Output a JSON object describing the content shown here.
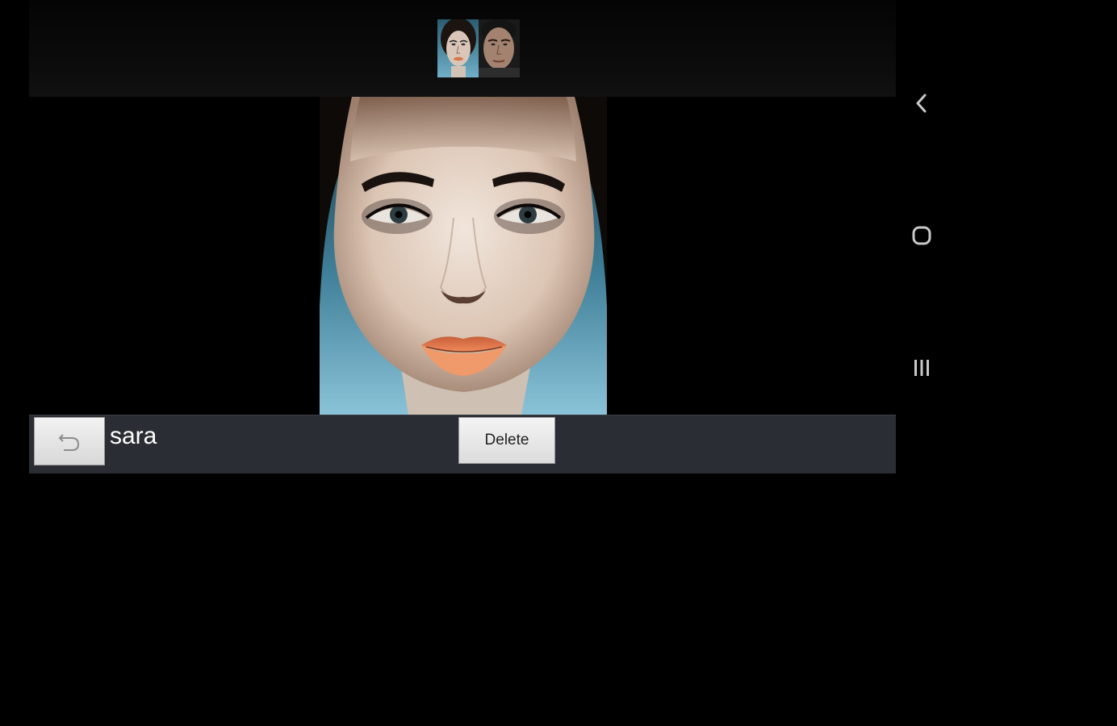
{
  "gallery": {
    "thumbnails": [
      {
        "icon": "woman-face-thumbnail"
      },
      {
        "icon": "man-face-thumbnail"
      }
    ]
  },
  "photo": {
    "icon": "woman-face-photo"
  },
  "toolbar": {
    "undo_icon": "undo-icon",
    "name": "sara",
    "delete_label": "Delete"
  },
  "navigation": {
    "back_icon": "back-icon",
    "home_icon": "home-icon",
    "recents_icon": "recents-icon"
  },
  "colors": {
    "background": "#000000",
    "toolbar": "#2a2d33",
    "button": "#e6e6e6",
    "nav_icon": "#c8c8c8"
  }
}
